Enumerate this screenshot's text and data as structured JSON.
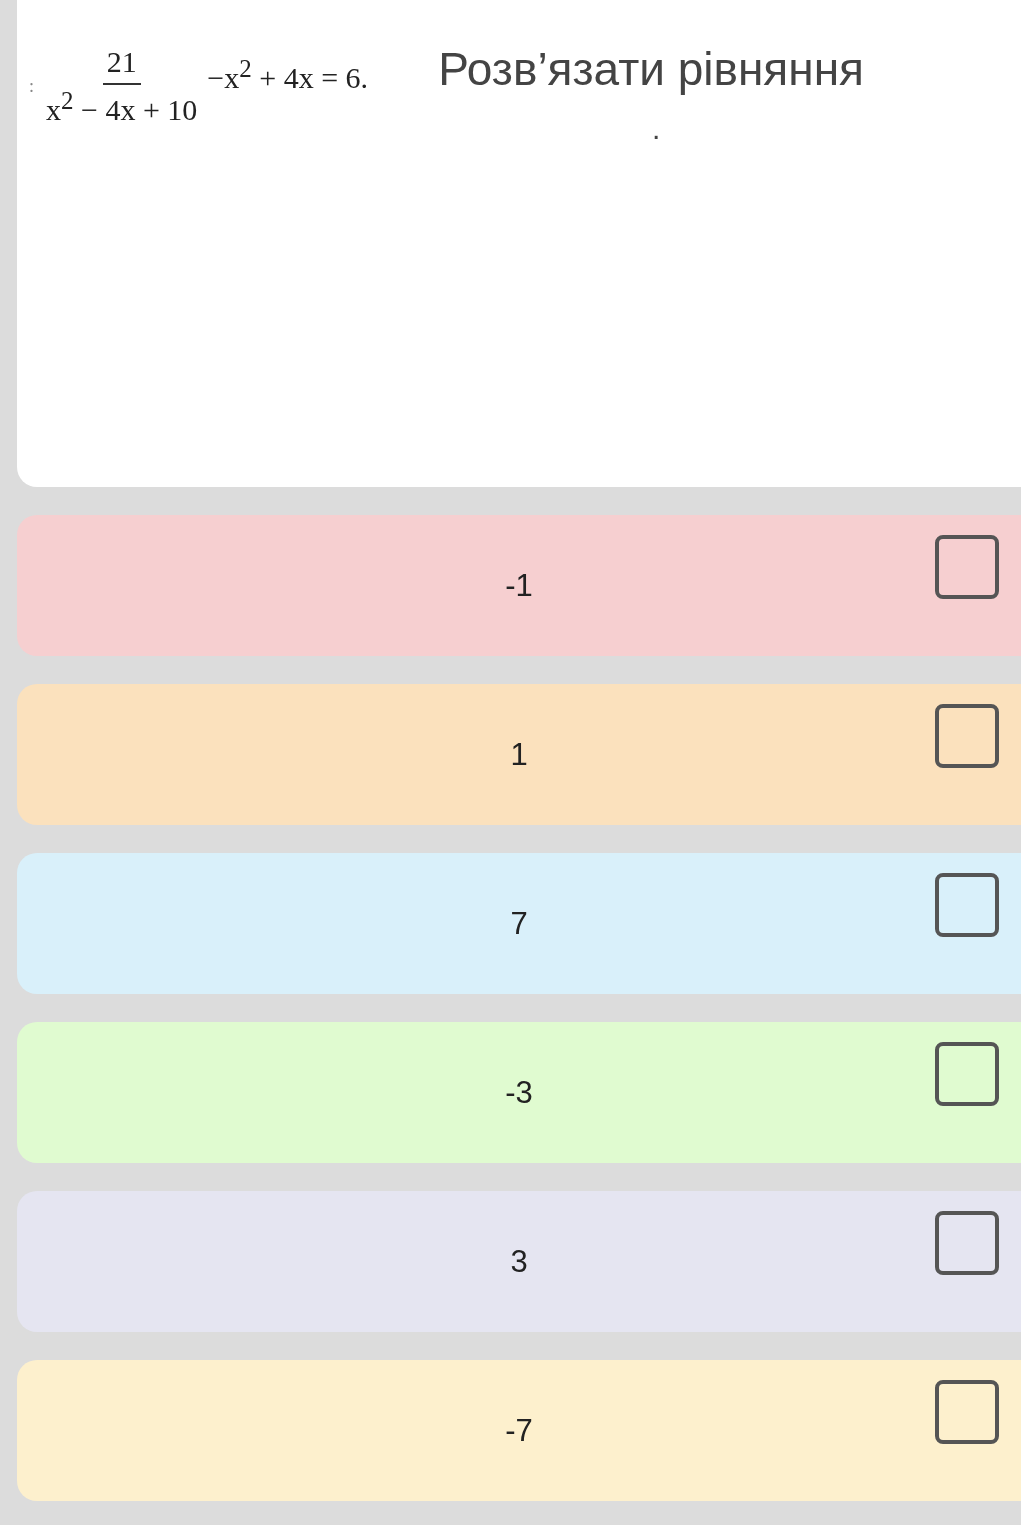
{
  "question": {
    "equation": {
      "prefix": ":",
      "numerator": "21",
      "denominator": "x$^{2}$ − 4x + 10",
      "rest": "−x$^{2}$ + 4x = 6."
    },
    "title": "Розв’язати рівняння",
    "note": "."
  },
  "options": [
    {
      "label": "-1",
      "checked": false,
      "color": "#f6cfd0"
    },
    {
      "label": "1",
      "checked": false,
      "color": "#fbe1bd"
    },
    {
      "label": "7",
      "checked": false,
      "color": "#d9f0fa"
    },
    {
      "label": "-3",
      "checked": false,
      "color": "#e0fbd0"
    },
    {
      "label": "3",
      "checked": false,
      "color": "#e5e5f1"
    },
    {
      "label": "-7",
      "checked": false,
      "color": "#fdf0cd"
    }
  ]
}
